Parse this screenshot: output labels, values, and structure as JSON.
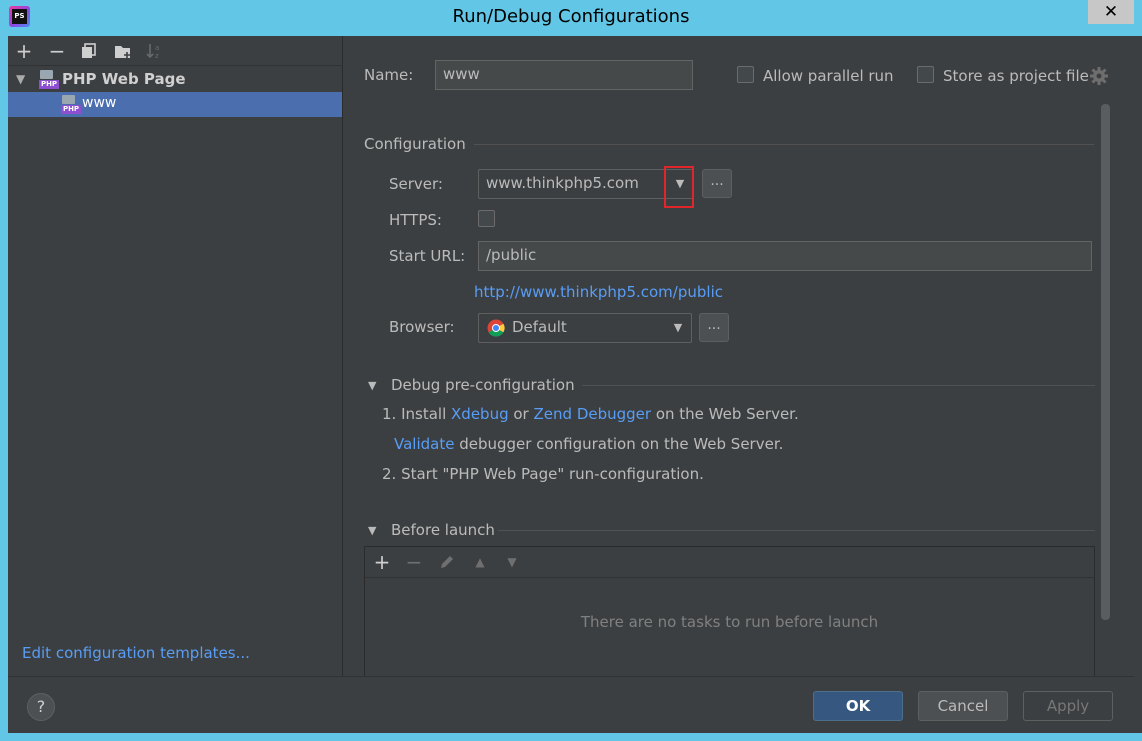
{
  "window": {
    "title": "Run/Debug Configurations",
    "app_icon_text": "PS",
    "close_glyph": "✕"
  },
  "sidebar": {
    "toolbar_icons": [
      "add-icon",
      "remove-icon",
      "copy-icon",
      "new-folder-icon",
      "sort-icon"
    ],
    "tree": {
      "group_label": "PHP Web Page",
      "selected_item": "www",
      "php_tag": "PHP"
    },
    "edit_templates_link": "Edit configuration templates..."
  },
  "form": {
    "name_label": "Name:",
    "name_value": "www",
    "allow_parallel_label": "Allow parallel run",
    "store_project_label": "Store as project file",
    "configuration_title": "Configuration",
    "server_label": "Server:",
    "server_value": "www.thinkphp5.com",
    "dots": "...",
    "https_label": "HTTPS:",
    "start_url_label": "Start URL:",
    "start_url_value": "/public",
    "resolved_url": "http://www.thinkphp5.com/public",
    "browser_label": "Browser:",
    "browser_value": "Default"
  },
  "debug": {
    "title": "Debug pre-configuration",
    "step1_prefix": "1. Install",
    "xdebug": "Xdebug",
    "or": "or",
    "zend": "Zend Debugger",
    "step1_suffix": "on the Web Server.",
    "validate": "Validate",
    "validate_suffix": "debugger configuration on the Web Server.",
    "step2": "2. Start \"PHP Web Page\" run-configuration."
  },
  "before_launch": {
    "title": "Before launch",
    "empty_text": "There are no tasks to run before launch"
  },
  "buttons": {
    "help": "?",
    "ok": "OK",
    "cancel": "Cancel",
    "apply": "Apply"
  },
  "colors": {
    "background": "#3c3f41",
    "selection": "#4b6eaf",
    "link": "#589df6",
    "ok_button": "#365880",
    "highlight": "#e0262b",
    "frame": "#62c6e6"
  }
}
